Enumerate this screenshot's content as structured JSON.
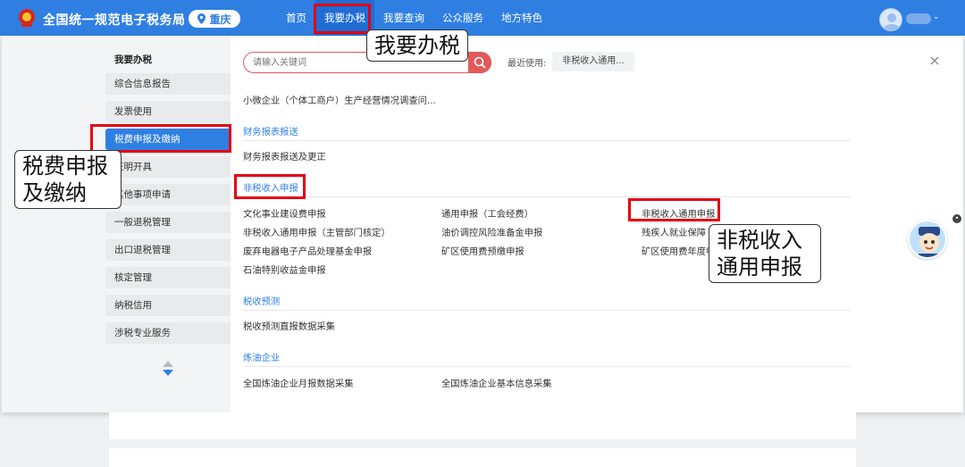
{
  "header": {
    "site_title": "全国统一规范电子税务局",
    "region": "重庆",
    "nav": [
      "首页",
      "我要办税",
      "我要查询",
      "公众服务",
      "地方特色"
    ]
  },
  "sidebar": {
    "title": "我要办税",
    "items": [
      "综合信息报告",
      "发票使用",
      "税费申报及缴纳",
      "证明开具",
      "其他事项申请",
      "一般退税管理",
      "出口退税管理",
      "核定管理",
      "纳税信用",
      "涉税专业服务"
    ]
  },
  "search": {
    "placeholder": "请输入关键词",
    "recent_label": "最近使用:",
    "recent_item": "非税收入通用..."
  },
  "content": {
    "partial_top": "小微企业（个体工商户）生产经营情况调查问...",
    "sections": [
      {
        "title": "财务报表报送",
        "items": [
          "财务报表报送及更正"
        ]
      },
      {
        "title": "非税收入申报",
        "items": [
          "文化事业建设费申报",
          "通用申报（工会经费）",
          "非税收入通用申报",
          "非税收入通用申报（主管部门核定）",
          "油价调控风险准备金申报",
          "残疾人就业保障",
          "废弃电器电子产品处理基金申报",
          "矿区使用费预缴申报",
          "矿区使用费年度申",
          "石油特别收益金申报"
        ]
      },
      {
        "title": "税收预测",
        "items": [
          "税收预测直报数据采集"
        ]
      },
      {
        "title": "炼油企业",
        "items": [
          "全国炼油企业月报数据采集",
          "全国炼油企业基本信息采集"
        ]
      }
    ]
  },
  "callouts": {
    "nav": "我要办税",
    "sidebar_line1": "税费申报",
    "sidebar_line2": "及缴纳",
    "item_line1": "非税收入",
    "item_line2": "通用申报"
  },
  "colors": {
    "brand": "#2f7fe3",
    "highlight": "#e50012"
  }
}
